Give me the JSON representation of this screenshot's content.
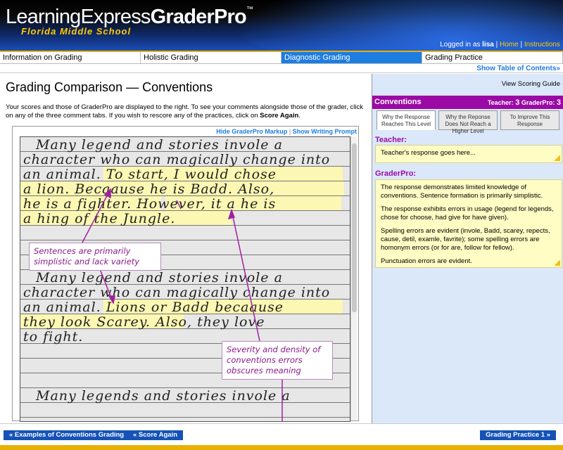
{
  "header": {
    "logo_main": "LearningExpress",
    "logo_product": "GraderPro",
    "logo_tm": "™",
    "subtitle": "Florida Middle School",
    "login_prefix": "Logged in as",
    "user": "lisa",
    "home_link": "Home",
    "instructions_link": "Instructions"
  },
  "nav": {
    "tabs": [
      {
        "label": "Information on Grading"
      },
      {
        "label": "Holistic Grading"
      },
      {
        "label": "Diagnostic Grading"
      },
      {
        "label": "Grading Practice"
      }
    ],
    "active_index": 2,
    "toc_link": "Show Table of Contents"
  },
  "main": {
    "title": "Grading Comparison — Conventions",
    "intro_before": "Your scores and those of GraderPro are displayed to the right. To see your comments alongside those of the grader, click on any of the three comment tabs. If you wish to rescore any of the practices, click on ",
    "intro_bold": "Score Again",
    "intro_after": ".",
    "hide_markup": "Hide GraderPro Markup",
    "show_prompt": "Show Writing Prompt",
    "essay_lines": [
      "Many legend and stories invole a",
      "character who can magically change into",
      "an animal. To start, I would chose",
      "a lion. Becaause he is Badd. Also,",
      "he is a fighter. However, it a he is",
      "a hing of the Jungle.",
      "Many legend and stories invole a",
      "character who can magically change into",
      "an animal. Lions or Badd becaause",
      "they look Scarey. Also, they love",
      "to fight.",
      "Many legends and stories invole a"
    ],
    "annotation_1": "Sentences are primarily simplistic and lack variety",
    "annotation_2": "Severity and density of conventions errors obscures meaning"
  },
  "right": {
    "scoring_guide": "View Scoring Guide",
    "section_title": "Conventions",
    "teacher_label": "Teacher:",
    "teacher_score": "3",
    "graderpro_label": "GraderPro:",
    "graderpro_score": "3",
    "tabs": [
      {
        "label": "Why the Response Reaches This Level"
      },
      {
        "label": "Why the Reponse Does Not Reach a Higher Level"
      },
      {
        "label": "To Improve This Response"
      }
    ],
    "teacher_heading": "Teacher:",
    "teacher_response": "Teacher's response goes here...",
    "graderpro_heading": "GraderPro:",
    "gp_p1": "The response demonstrates limited knowledge of conventions. Sentence formation is primarily simplistic.",
    "gp_p2": "The response exhibits errors in usage (legend for legends, chose for choose, had give for have given).",
    "gp_p3": "Spelling errors are evident (invole, Badd, scarey, repects, cause, detil, examle, favrite); some spelling errors are homonym errors (or for are, follow for fellow).",
    "gp_p4": "Punctuation errors are evident."
  },
  "footer": {
    "btn_examples": "« Examples of Conventions Grading",
    "btn_score_again": "« Score Again",
    "btn_practice": "Grading Practice 1 »"
  },
  "colors": {
    "accent_purple": "#9b0aa5",
    "nav_active": "#1d7de0",
    "button_blue": "#1452b8",
    "gold": "#e8b100"
  }
}
